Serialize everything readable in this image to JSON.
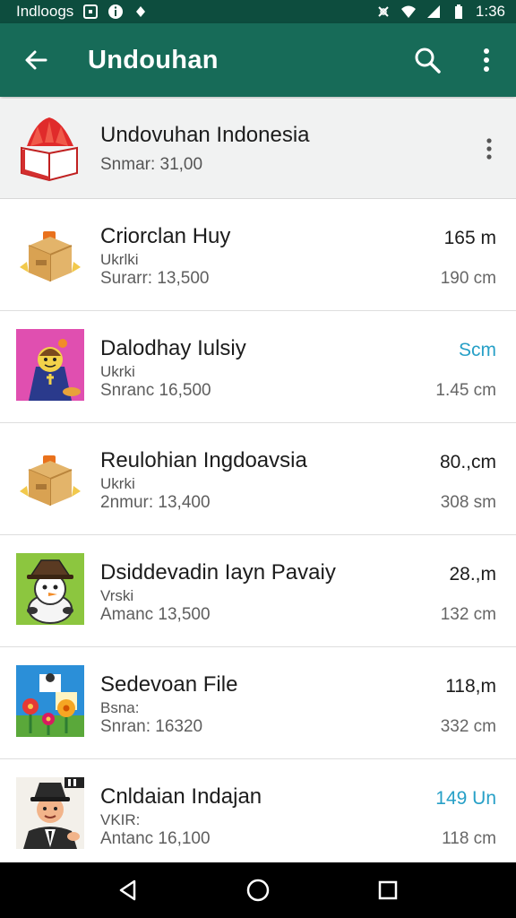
{
  "status_bar": {
    "left_text": "Indloogs",
    "time": "1:36",
    "icons": [
      "notification-icon",
      "info-icon",
      "location-icon",
      "data-sync-icon",
      "wifi-icon",
      "signal-icon",
      "battery-icon"
    ]
  },
  "app_bar": {
    "title": "Undouhan",
    "back_icon": "back-arrow-icon",
    "search_icon": "search-icon",
    "more_icon": "more-vert-icon"
  },
  "header": {
    "title": "Undovuhan Indonesia",
    "subtitle": "Snmar: 31,00",
    "logo_icon": "book-logo-icon"
  },
  "rows": [
    {
      "name": "Criorclan Huy",
      "tag": "Ukrlki",
      "count": "Surarr: 13,500",
      "size": "165 m",
      "size_accent": false,
      "sub": "190 cm",
      "icon": "package-box-icon"
    },
    {
      "name": "Dalodhay Iulsiy",
      "tag": "Ukrki",
      "count": "Snranc 16,500",
      "size": "Scm",
      "size_accent": true,
      "sub": "1.45 cm",
      "icon": "character-pink-icon"
    },
    {
      "name": "Reulohian Ingdoavsia",
      "tag": "Ukrki",
      "count": "2nmur: 13,400",
      "size": "80.,cm",
      "size_accent": false,
      "sub": "308 sm",
      "icon": "package-box-icon"
    },
    {
      "name": "Dsiddevadin Iayn Pavaiy",
      "tag": "Vrski",
      "count": "Amanc 13,500",
      "size": "28.,m",
      "size_accent": false,
      "sub": "132 cm",
      "icon": "snowman-hat-icon"
    },
    {
      "name": "Sedevoan File",
      "tag": "Bsna:",
      "count": "Snran: 16320",
      "size": "118,m",
      "size_accent": false,
      "sub": "332 cm",
      "icon": "flowers-icon"
    },
    {
      "name": "Cnldaian Indajan",
      "tag": "VKIR:",
      "count": "Antanc 16,100",
      "size": "149 Un",
      "size_accent": true,
      "sub": "118 cm",
      "icon": "man-hat-icon"
    }
  ],
  "nav_bar": {
    "back_icon": "nav-back-icon",
    "home_icon": "nav-home-icon",
    "recents_icon": "nav-recents-icon"
  },
  "colors": {
    "status_bar": "#0d4d3e",
    "app_bar": "#176b58",
    "accent": "#27a0c7",
    "header_bg": "#f1f2f2"
  }
}
